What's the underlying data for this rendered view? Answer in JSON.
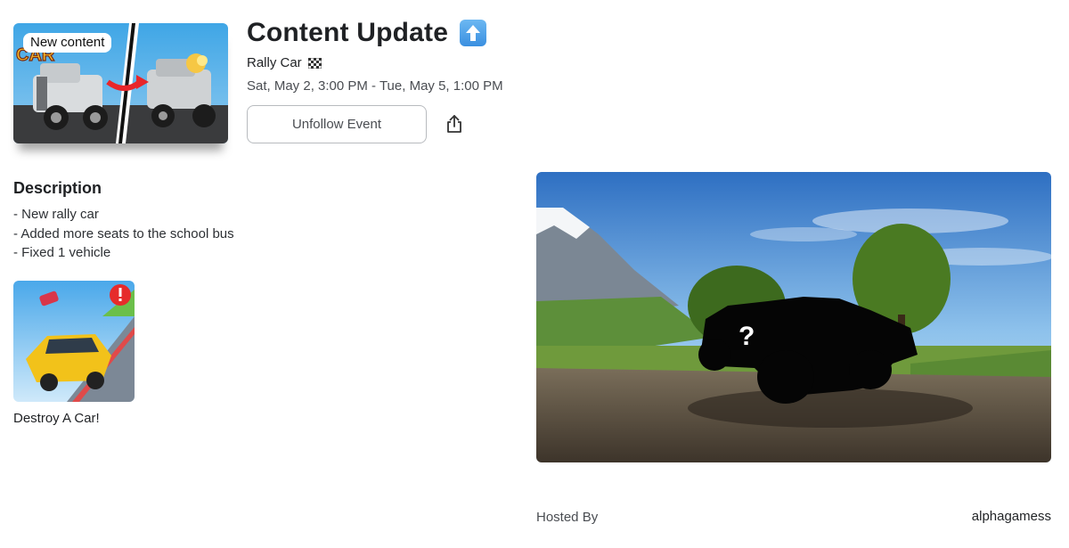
{
  "event": {
    "thumbnail_badge": "New content",
    "thumbnail_text": "CAR",
    "title": "Content Update",
    "title_icon": "up-arrow-icon",
    "subtitle": "Rally Car",
    "subtitle_icon": "checkered-flag-icon",
    "date_range": "Sat, May 2, 3:00 PM - Tue, May 5, 1:00 PM",
    "unfollow_label": "Unfollow Event",
    "share_icon": "share-icon"
  },
  "description": {
    "heading": "Description",
    "lines": [
      "- New rally car",
      "- Added more seats to the school bus",
      "- Fixed 1 vehicle"
    ]
  },
  "game": {
    "name": "Destroy A Car!"
  },
  "hero": {
    "overlay_glyph": "?"
  },
  "host": {
    "label": "Hosted By",
    "name": "alphagamess"
  },
  "colors": {
    "accent": "#3a8fe0",
    "border": "#b8bbbf",
    "text_primary": "#1f2124",
    "text_secondary": "#4a4d52"
  }
}
